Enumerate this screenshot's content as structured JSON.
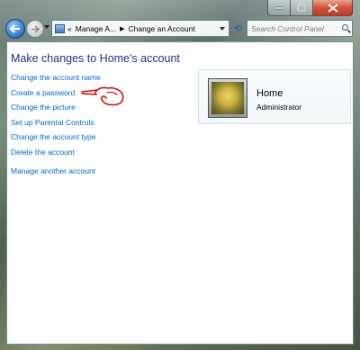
{
  "window": {
    "caption_buttons": [
      "minimize",
      "maximize",
      "close"
    ]
  },
  "navbar": {
    "breadcrumb_prefix": "«",
    "breadcrumb": [
      "Manage A...",
      "Change an Account"
    ],
    "search_placeholder": "Search Control Panel"
  },
  "main": {
    "title": "Make changes to Home's account",
    "links": [
      "Change the account name",
      "Create a password",
      "Change the picture",
      "Set up Parental Controls",
      "Change the account type",
      "Delete the account",
      "Manage another account"
    ],
    "annotation": "red hand-drawn pointing hand next to \"Create a password\""
  },
  "account": {
    "name": "Home",
    "role": "Administrator",
    "avatar": "dog-picture"
  },
  "colors": {
    "title": "#1e3287",
    "link": "#0066cc",
    "annotation": "#d81010",
    "close_button": "#c23a22"
  }
}
